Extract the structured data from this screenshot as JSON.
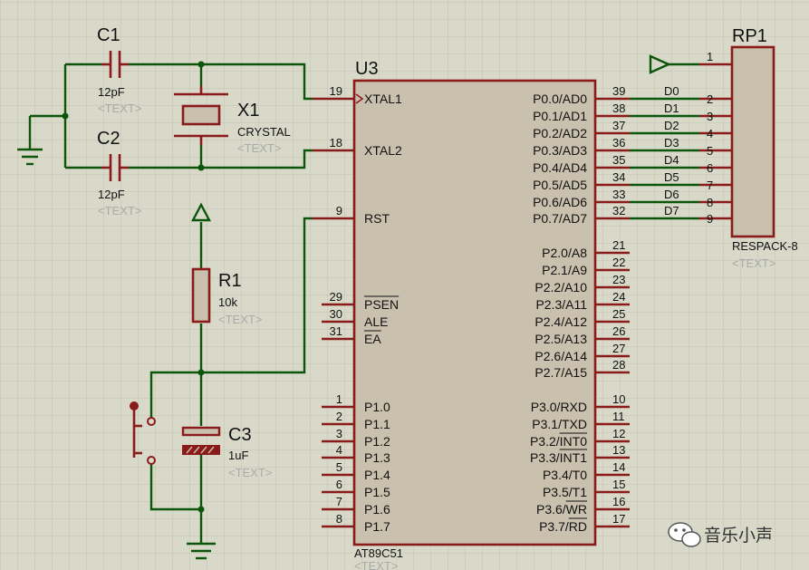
{
  "chip": {
    "ref": "U3",
    "part": "AT89C51",
    "text": "<TEXT>",
    "left_pins": [
      {
        "num": "19",
        "name": "XTAL1"
      },
      {
        "num": "18",
        "name": "XTAL2"
      },
      {
        "num": "9",
        "name": "RST"
      },
      {
        "num": "29",
        "name": "PSEN"
      },
      {
        "num": "30",
        "name": "ALE"
      },
      {
        "num": "31",
        "name": "EA"
      },
      {
        "num": "1",
        "name": "P1.0"
      },
      {
        "num": "2",
        "name": "P1.1"
      },
      {
        "num": "3",
        "name": "P1.2"
      },
      {
        "num": "4",
        "name": "P1.3"
      },
      {
        "num": "5",
        "name": "P1.4"
      },
      {
        "num": "6",
        "name": "P1.5"
      },
      {
        "num": "7",
        "name": "P1.6"
      },
      {
        "num": "8",
        "name": "P1.7"
      }
    ],
    "right_pins": [
      {
        "num": "39",
        "name": "P0.0/AD0"
      },
      {
        "num": "38",
        "name": "P0.1/AD1"
      },
      {
        "num": "37",
        "name": "P0.2/AD2"
      },
      {
        "num": "36",
        "name": "P0.3/AD3"
      },
      {
        "num": "35",
        "name": "P0.4/AD4"
      },
      {
        "num": "34",
        "name": "P0.5/AD5"
      },
      {
        "num": "33",
        "name": "P0.6/AD6"
      },
      {
        "num": "32",
        "name": "P0.7/AD7"
      },
      {
        "num": "21",
        "name": "P2.0/A8"
      },
      {
        "num": "22",
        "name": "P2.1/A9"
      },
      {
        "num": "23",
        "name": "P2.2/A10"
      },
      {
        "num": "24",
        "name": "P2.3/A11"
      },
      {
        "num": "25",
        "name": "P2.4/A12"
      },
      {
        "num": "26",
        "name": "P2.5/A13"
      },
      {
        "num": "27",
        "name": "P2.6/A14"
      },
      {
        "num": "28",
        "name": "P2.7/A15"
      },
      {
        "num": "10",
        "name": "P3.0/RXD"
      },
      {
        "num": "11",
        "name": "P3.1/TXD"
      },
      {
        "num": "12",
        "name": "P3.2/INT0"
      },
      {
        "num": "13",
        "name": "P3.3/INT1"
      },
      {
        "num": "14",
        "name": "P3.4/T0"
      },
      {
        "num": "15",
        "name": "P3.5/T1"
      },
      {
        "num": "16",
        "name": "P3.6/WR"
      },
      {
        "num": "17",
        "name": "P3.7/RD"
      }
    ]
  },
  "c1": {
    "ref": "C1",
    "value": "12pF",
    "text": "<TEXT>"
  },
  "c2": {
    "ref": "C2",
    "value": "12pF",
    "text": "<TEXT>"
  },
  "x1": {
    "ref": "X1",
    "value": "CRYSTAL",
    "text": "<TEXT>"
  },
  "r1": {
    "ref": "R1",
    "value": "10k",
    "text": "<TEXT>"
  },
  "c3": {
    "ref": "C3",
    "value": "1uF",
    "text": "<TEXT>"
  },
  "rp1": {
    "ref": "RP1",
    "part": "RESPACK-8",
    "text": "<TEXT>",
    "common_pin": "1",
    "pins": [
      "2",
      "3",
      "4",
      "5",
      "6",
      "7",
      "8",
      "9"
    ]
  },
  "bus": {
    "labels": [
      "D0",
      "D1",
      "D2",
      "D3",
      "D4",
      "D5",
      "D6",
      "D7"
    ]
  },
  "watermark": {
    "text": "音乐小声"
  },
  "colors": {
    "background": "#d9d9c9",
    "grid": "#c4c4b3",
    "wire": "#0b560b",
    "pin": "#8b1a1a",
    "chip_fill": "#c9c1ae",
    "label": "#111111",
    "placeholder": "#aaaaaa"
  }
}
